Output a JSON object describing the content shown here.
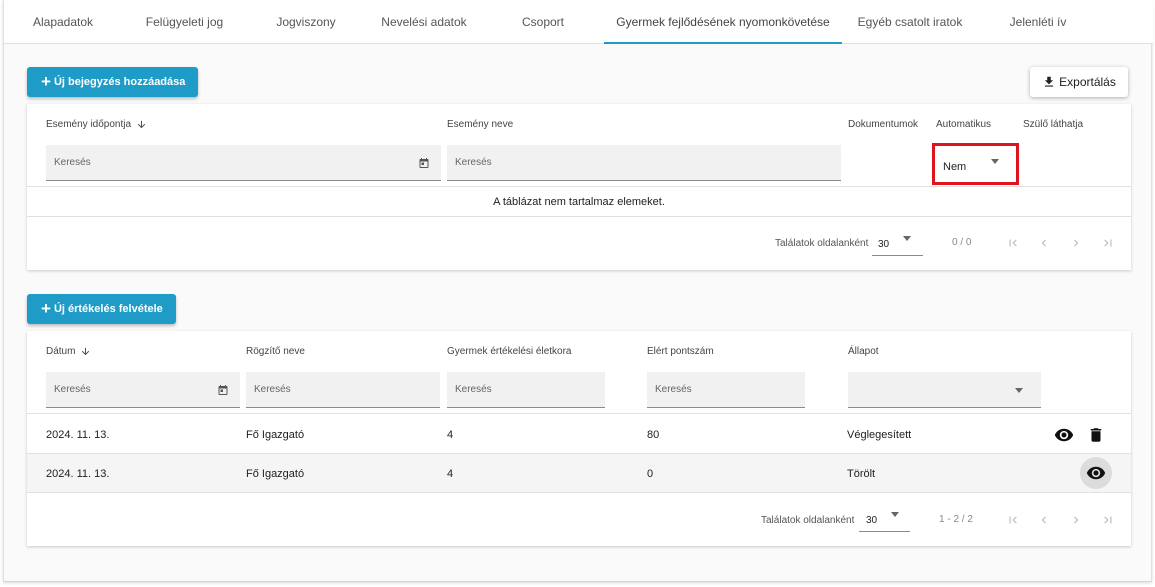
{
  "tabs": [
    {
      "label": "Alapadatok"
    },
    {
      "label": "Felügyeleti jog"
    },
    {
      "label": "Jogviszony"
    },
    {
      "label": "Nevelési adatok"
    },
    {
      "label": "Csoport"
    },
    {
      "label": "Gyermek fejlődésének nyomonkövetése",
      "active": true
    },
    {
      "label": "Egyéb csatolt iratok"
    },
    {
      "label": "Jelenléti ív"
    }
  ],
  "events": {
    "add_button": "Új bejegyzés hozzáadása",
    "export_button": "Exportálás",
    "columns": {
      "date": "Esemény időpontja",
      "name": "Esemény neve",
      "documents": "Dokumentumok",
      "automatic": "Automatikus",
      "parent_visible": "Szülő láthatja"
    },
    "filters": {
      "date_placeholder": "Keresés",
      "name_placeholder": "Keresés",
      "automatic_value": "Nem"
    },
    "empty_message": "A táblázat nem tartalmaz elemeket.",
    "pagination": {
      "label": "Találatok oldalanként",
      "page_size": "30",
      "range": "0 / 0"
    }
  },
  "evaluations": {
    "add_button": "Új értékelés felvétele",
    "columns": {
      "date": "Dátum",
      "recorder": "Rögzítő neve",
      "age": "Gyermek értékelési életkora",
      "score": "Elért pontszám",
      "status": "Állapot"
    },
    "filters": {
      "date_placeholder": "Keresés",
      "recorder_placeholder": "Keresés",
      "age_placeholder": "Keresés",
      "score_placeholder": "Keresés",
      "status_value": ""
    },
    "rows": [
      {
        "date": "2024. 11. 13.",
        "recorder": "Fő Igazgató",
        "age": "4",
        "score": "80",
        "status": "Véglegesített"
      },
      {
        "date": "2024. 11. 13.",
        "recorder": "Fő Igazgató",
        "age": "4",
        "score": "0",
        "status": "Törölt"
      }
    ],
    "pagination": {
      "label": "Találatok oldalanként",
      "page_size": "30",
      "range": "1 - 2 / 2"
    }
  },
  "icons": {
    "sort_down": "arrow-down-icon",
    "calendar": "calendar-icon",
    "download": "download-icon",
    "view": "eye-icon",
    "delete": "trash-icon",
    "first": "first-page-icon",
    "prev": "chevron-left-icon",
    "next": "chevron-right-icon",
    "last": "last-page-icon"
  },
  "colors": {
    "accent": "#1e9cc7",
    "highlight": "#e0141e"
  }
}
